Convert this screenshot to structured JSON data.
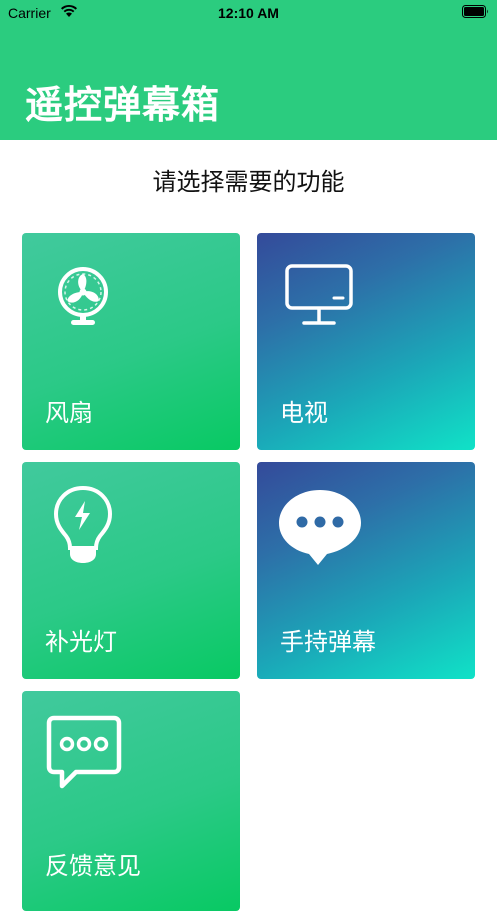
{
  "status_bar": {
    "carrier": "Carrier",
    "time": "12:10 AM"
  },
  "header": {
    "title": "遥控弹幕箱",
    "background_color": "#2bcc7f"
  },
  "subtitle": "请选择需要的功能",
  "cards": [
    {
      "label": "风扇",
      "icon": "fan-icon",
      "style": "green"
    },
    {
      "label": "电视",
      "icon": "tv-icon",
      "style": "blue"
    },
    {
      "label": "补光灯",
      "icon": "lightbulb-icon",
      "style": "green"
    },
    {
      "label": "手持弹幕",
      "icon": "chat-bubble-icon",
      "style": "blue"
    },
    {
      "label": "反馈意见",
      "icon": "feedback-icon",
      "style": "green"
    }
  ]
}
